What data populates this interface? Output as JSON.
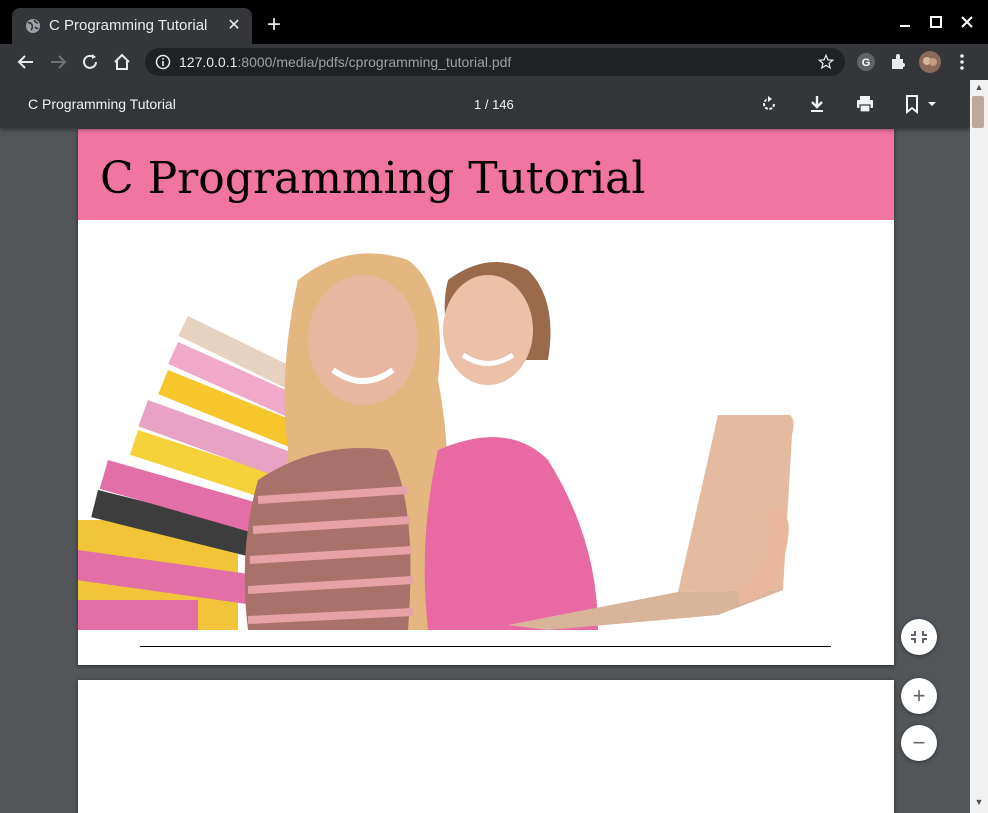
{
  "browser": {
    "tab_title": "C Programming Tutorial",
    "new_tab_label": "+",
    "close_tab_label": "✕",
    "url_host": "127.0.0.1",
    "url_rest": ":8000/media/pdfs/cprogramming_tutorial.pdf"
  },
  "pdf_viewer": {
    "title": "C Programming Tutorial",
    "page_indicator": "1 / 146",
    "zoom_in_label": "+",
    "zoom_out_label": "−"
  },
  "document": {
    "heading": "C Programming Tutorial",
    "banner_color": "#f075a0"
  },
  "icons": [
    "globe-icon",
    "close-icon",
    "plus-icon",
    "minimize-icon",
    "maximize-icon",
    "window-close-icon",
    "back-icon",
    "forward-icon",
    "reload-icon",
    "home-icon",
    "info-icon",
    "star-icon",
    "google-icon",
    "extensions-icon",
    "avatar",
    "menu-icon",
    "rotate-icon",
    "download-icon",
    "print-icon",
    "bookmark-icon",
    "fit-icon",
    "zoom-in-icon",
    "zoom-out-icon"
  ]
}
